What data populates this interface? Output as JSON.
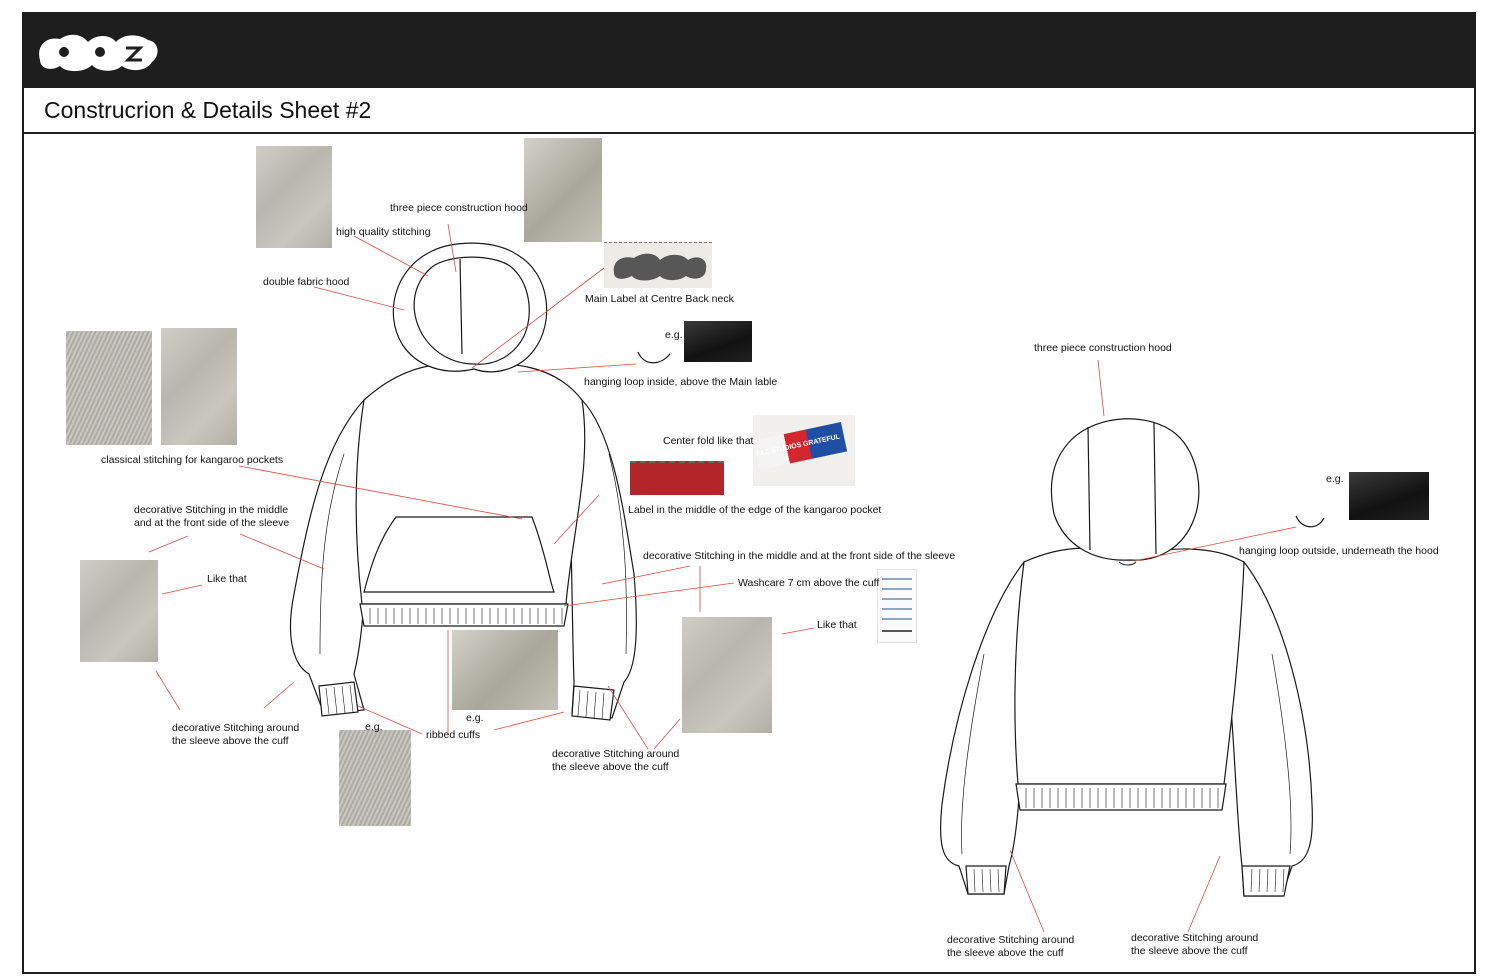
{
  "header": {
    "logo_text": "FAZ",
    "title": "Construcrion & Details Sheet #2"
  },
  "colors": {
    "header_bar": "#1e1e1e",
    "leader_lines": "#e0483f",
    "sketch_lines": "#1a1a1a"
  },
  "front_view": {
    "annotations": {
      "hood_three_piece": "three piece construction hood",
      "high_quality_stitching": "high quality stitching",
      "double_fabric_hood": "double fabric hood",
      "main_label": "Main Label at Centre Back neck",
      "eg_loop": "e.g.",
      "hanging_loop_inside": "hanging loop inside, above the Main lable",
      "classical_stitching": "classical stitching for kangaroo pockets",
      "center_fold": "Center fold like that",
      "label_kangaroo": "Label in the middle of the edge of the kangaroo pocket",
      "decorative_sleeve_left": "decorative Stitching in the middle and at the front side of the sleeve",
      "like_that_left": "Like that",
      "decorative_sleeve_right": "decorative Stitching in the middle and at the front side of the sleeve",
      "washcare": "Washcare 7 cm above the cuff",
      "like_that_right": "Like that",
      "cuff_stitch_left": "decorative Stitching around the sleeve above the cuff",
      "eg_cuff": "e.g.",
      "eg_ribbed": "e.g.",
      "ribbed_cuffs": "ribbed cuffs",
      "cuff_stitch_right": "decorative Stitching around the sleeve above the cuff"
    },
    "label_photo_text": "FAZ STUDIOS GRATEFUL"
  },
  "back_view": {
    "annotations": {
      "hood_three_piece": "three piece construction hood",
      "eg_loop": "e.g.",
      "hanging_loop_outside": "hanging loop outside, underneath the hood",
      "cuff_stitch_left": "decorative Stitching around the sleeve above the cuff",
      "cuff_stitch_right": "decorative Stitching around the sleeve above the cuff"
    }
  }
}
